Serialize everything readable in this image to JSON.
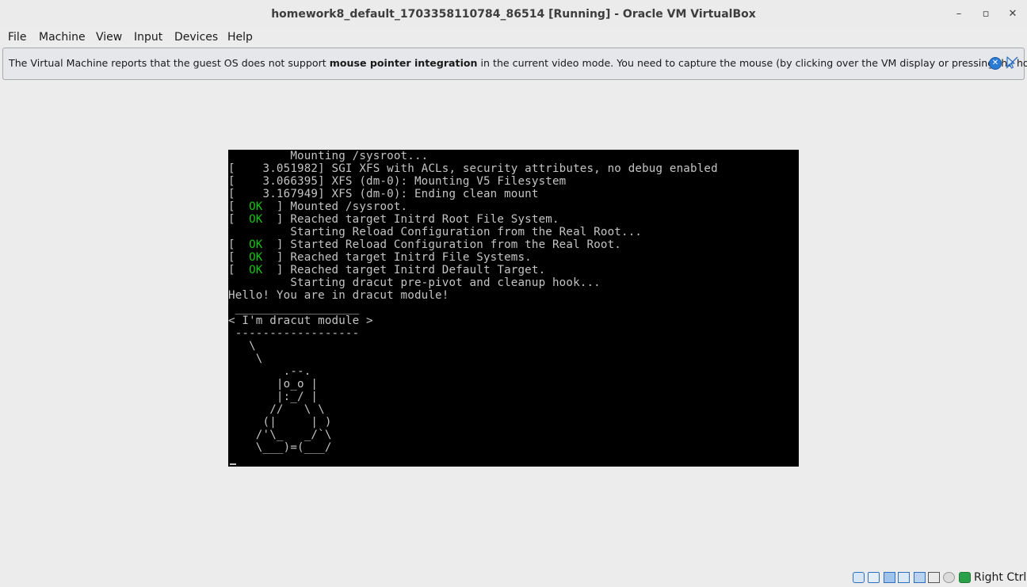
{
  "window": {
    "title": "homework8_default_1703358110784_86514 [Running] - Oracle VM VirtualBox",
    "controls": {
      "minimize": "–",
      "maximize": "▫",
      "close": "✕"
    }
  },
  "menubar": {
    "items": [
      "File",
      "Machine",
      "View",
      "Input",
      "Devices",
      "Help"
    ]
  },
  "banner": {
    "text_before": "The Virtual Machine reports that the guest OS does not support ",
    "text_bold": "mouse pointer integration",
    "text_after": " in the current video mode. You need to capture the mouse (by clicking over the VM display or pressing the host key)",
    "close_glyph": "✕"
  },
  "console": {
    "lines": [
      {
        "pre": "         Mounting /sysroot...",
        "ok": "",
        "post": ""
      },
      {
        "pre": "[    3.051982] SGI XFS with ACLs, security attributes, no debug enabled",
        "ok": "",
        "post": ""
      },
      {
        "pre": "[    3.066395] XFS (dm-0): Mounting V5 Filesystem",
        "ok": "",
        "post": ""
      },
      {
        "pre": "[    3.167949] XFS (dm-0): Ending clean mount",
        "ok": "",
        "post": ""
      },
      {
        "pre": "[  ",
        "ok": "OK",
        "post": "  ] Mounted /sysroot."
      },
      {
        "pre": "[  ",
        "ok": "OK",
        "post": "  ] Reached target Initrd Root File System."
      },
      {
        "pre": "         Starting Reload Configuration from the Real Root...",
        "ok": "",
        "post": ""
      },
      {
        "pre": "[  ",
        "ok": "OK",
        "post": "  ] Started Reload Configuration from the Real Root."
      },
      {
        "pre": "[  ",
        "ok": "OK",
        "post": "  ] Reached target Initrd File Systems."
      },
      {
        "pre": "[  ",
        "ok": "OK",
        "post": "  ] Reached target Initrd Default Target."
      },
      {
        "pre": "         Starting dracut pre-pivot and cleanup hook...",
        "ok": "",
        "post": ""
      },
      {
        "pre": "Hello! You are in dracut module!",
        "ok": "",
        "post": ""
      },
      {
        "pre": " __________________",
        "ok": "",
        "post": ""
      },
      {
        "pre": "< I'm dracut module >",
        "ok": "",
        "post": ""
      },
      {
        "pre": " ------------------",
        "ok": "",
        "post": ""
      },
      {
        "pre": "   \\",
        "ok": "",
        "post": ""
      },
      {
        "pre": "    \\",
        "ok": "",
        "post": ""
      },
      {
        "pre": "        .--.",
        "ok": "",
        "post": ""
      },
      {
        "pre": "       |o_o |",
        "ok": "",
        "post": ""
      },
      {
        "pre": "       |:_/ |",
        "ok": "",
        "post": ""
      },
      {
        "pre": "      //   \\ \\",
        "ok": "",
        "post": ""
      },
      {
        "pre": "     (|     | )",
        "ok": "",
        "post": ""
      },
      {
        "pre": "    /'\\_   _/`\\",
        "ok": "",
        "post": ""
      },
      {
        "pre": "    \\___)=(___/",
        "ok": "",
        "post": ""
      }
    ]
  },
  "statusbar": {
    "icons": [
      "hard-disk-icon",
      "optical-drive-icon",
      "network-icon",
      "usb-icon",
      "shared-folders-icon",
      "display-icon",
      "recording-icon",
      "mouse-integration-icon"
    ],
    "host_key": "Right Ctrl"
  },
  "colors": {
    "ok_green": "#17c217",
    "console_text": "#c4c4c4",
    "console_bg": "#000000",
    "window_bg": "#ececec"
  }
}
